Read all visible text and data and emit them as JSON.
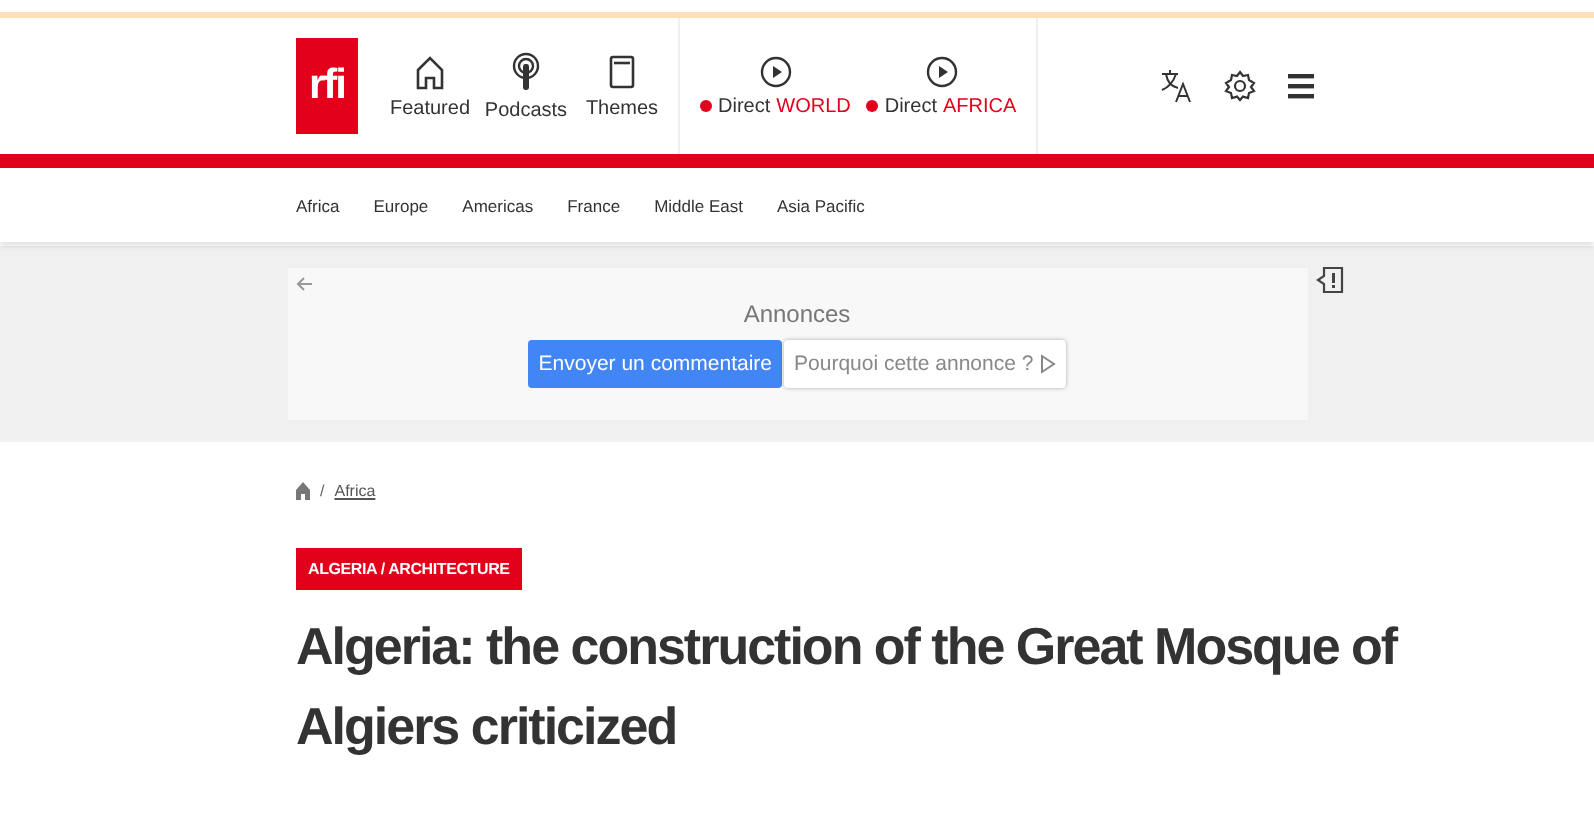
{
  "header": {
    "logo": "rfi",
    "nav": [
      {
        "label": "Featured",
        "kind": "home"
      },
      {
        "label": "Podcasts",
        "kind": "podcast"
      },
      {
        "label": "Themes",
        "kind": "book"
      }
    ],
    "live": [
      {
        "label": "Direct",
        "channel": "WORLD"
      },
      {
        "label": "Direct",
        "channel": "AFRICA"
      }
    ]
  },
  "regions": [
    "Africa",
    "Europe",
    "Americas",
    "France",
    "Middle East",
    "Asia Pacific"
  ],
  "ad": {
    "title": "Annonces",
    "feedback_button": "Envoyer un commentaire",
    "why_button": "Pourquoi cette annonce ?"
  },
  "breadcrumb_separator": "/",
  "breadcrumb": [
    "Africa"
  ],
  "tag": "ALGERIA / ARCHITECTURE",
  "headline": "Algeria: the construction of the Great Mosque of Algiers criticized"
}
